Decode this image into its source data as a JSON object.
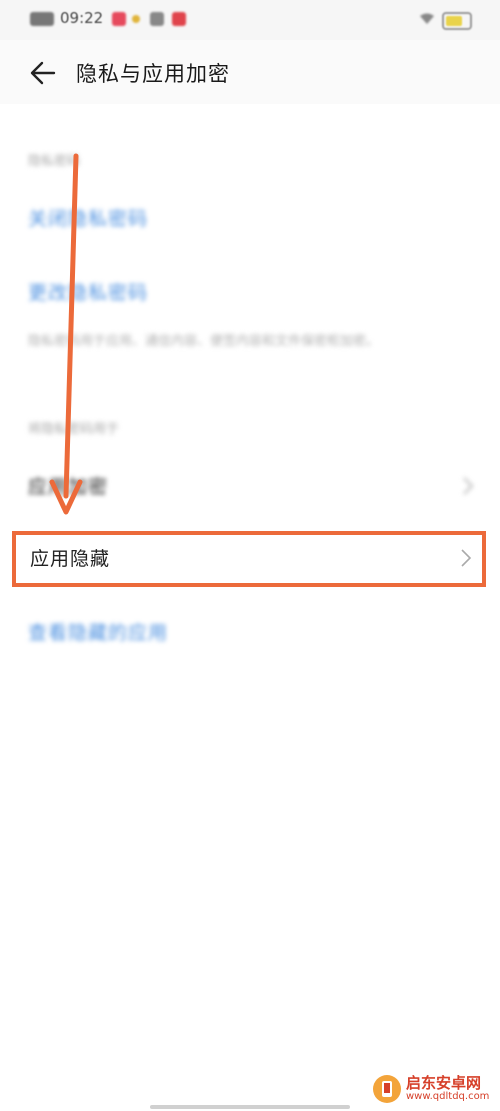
{
  "status_bar": {
    "time": "09:22",
    "icons": [
      "notification-icon",
      "location-dot-icon",
      "gallery-icon",
      "heart-icon",
      "wifi-icon",
      "battery-icon"
    ],
    "accent_colors": [
      "#e64a5d",
      "#e0b43a",
      "#888888",
      "#e0444c"
    ]
  },
  "header": {
    "title": "隐私与应用加密",
    "back_icon": "arrow-left-icon"
  },
  "sections": {
    "privacy_password_label": "隐私密码",
    "disable_password": "关闭隐私密码",
    "change_password": "更改隐私密码",
    "description": "隐私密码用于应用、通信内容、便签内容和文件保密柜加密。",
    "use_for_label": "将隐私密码用于",
    "app_encrypt": "应用加密",
    "app_hide": "应用隐藏",
    "view_hidden_apps": "查看隐藏的应用"
  },
  "colors": {
    "link_blue": "#4a8fe0",
    "annotation_orange": "#ec6a3a",
    "watermark_red": "#d6402a"
  },
  "watermark": {
    "name": "启东安卓网",
    "url": "www.qdltdq.com",
    "logo_icon": "phone-logo-icon"
  }
}
